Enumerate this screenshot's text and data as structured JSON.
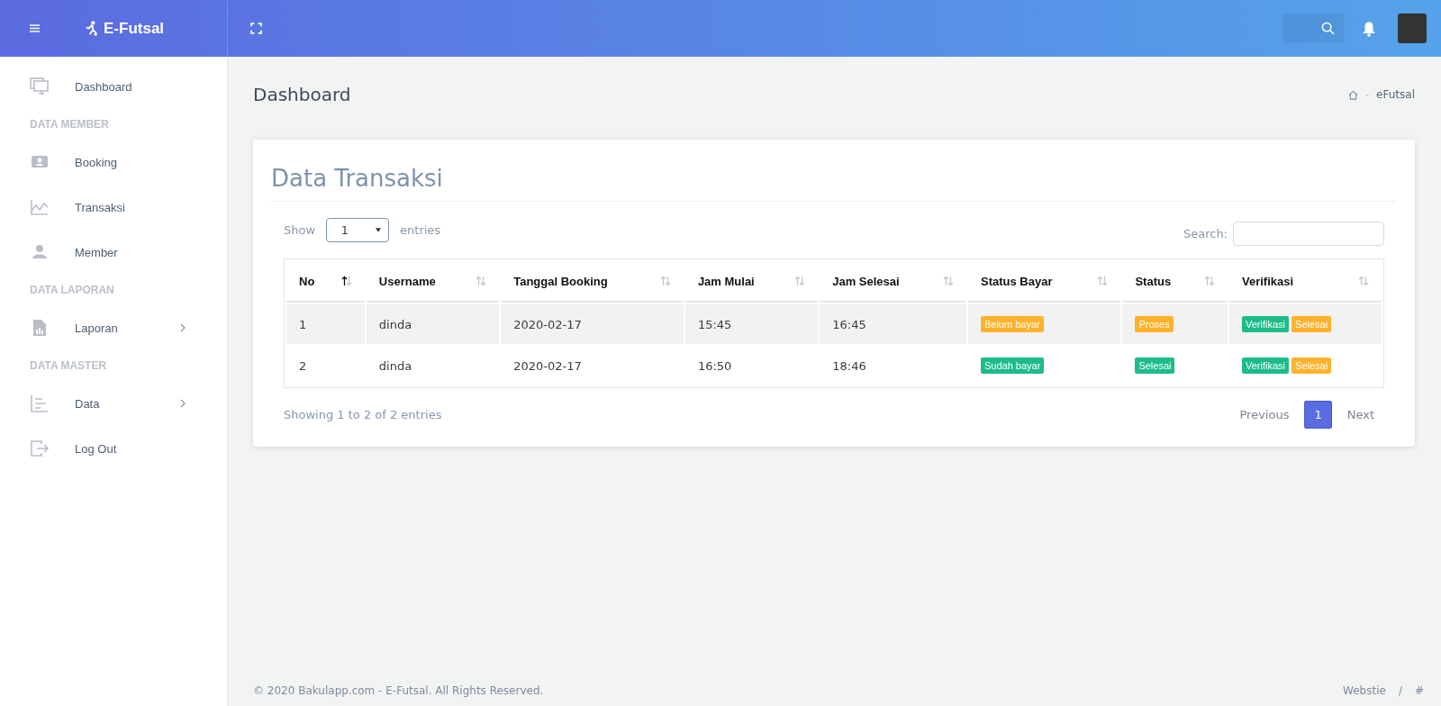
{
  "topbar": {
    "brand": "E-Futsal"
  },
  "sidebar": {
    "items": [
      {
        "kind": "item",
        "label": "Dashboard",
        "has_submenu": false
      },
      {
        "kind": "section",
        "label": "DATA MEMBER"
      },
      {
        "kind": "item",
        "label": "Booking",
        "has_submenu": false
      },
      {
        "kind": "item",
        "label": "Transaksi",
        "has_submenu": false
      },
      {
        "kind": "item",
        "label": "Member",
        "has_submenu": false
      },
      {
        "kind": "section",
        "label": "DATA LAPORAN"
      },
      {
        "kind": "item",
        "label": "Laporan",
        "has_submenu": true
      },
      {
        "kind": "section",
        "label": "DATA MASTER"
      },
      {
        "kind": "item",
        "label": "Data",
        "has_submenu": true
      },
      {
        "kind": "item",
        "label": "Log Out",
        "has_submenu": false
      }
    ]
  },
  "page": {
    "title": "Dashboard",
    "breadcrumb": {
      "separator": "-",
      "current": "eFutsal"
    }
  },
  "card": {
    "title": "Data Transaksi",
    "length": {
      "before": "Show",
      "value": "1",
      "after": "entries"
    },
    "search": {
      "label": "Search:"
    },
    "table": {
      "columns": [
        {
          "label": "No",
          "sorted": true
        },
        {
          "label": "Username",
          "sorted": false
        },
        {
          "label": "Tanggal Booking",
          "sorted": false
        },
        {
          "label": "Jam Mulai",
          "sorted": false
        },
        {
          "label": "Jam Selesai",
          "sorted": false
        },
        {
          "label": "Status Bayar",
          "sorted": false
        },
        {
          "label": "Status",
          "sorted": false
        },
        {
          "label": "Verifikasi",
          "sorted": false
        }
      ],
      "rows": [
        {
          "cells": [
            "1",
            "dinda",
            "2020-02-17",
            "15:45",
            "16:45"
          ],
          "status_bayar": [
            {
              "text": "Belum bayar",
              "color": "#ffb22b"
            }
          ],
          "status": [
            {
              "text": "Proses",
              "color": "#ffb22b"
            }
          ],
          "verifikasi": [
            {
              "text": "Verifikasi",
              "color": "#1ebc8b"
            },
            {
              "text": "Selesai",
              "color": "#ffb22b"
            }
          ]
        },
        {
          "cells": [
            "2",
            "dinda",
            "2020-02-17",
            "16:50",
            "18:46"
          ],
          "status_bayar": [
            {
              "text": "Sudah bayar",
              "color": "#1ebc8b"
            }
          ],
          "status": [
            {
              "text": "Selesai",
              "color": "#1ebc8b"
            }
          ],
          "verifikasi": [
            {
              "text": "Verifikasi",
              "color": "#1ebc8b"
            },
            {
              "text": "Selesai",
              "color": "#ffb22b"
            }
          ]
        }
      ]
    },
    "info": "Showing 1 to 2 of 2 entries",
    "pagination": [
      {
        "label": "Previous",
        "selected": false
      },
      {
        "label": "1",
        "selected": true
      },
      {
        "label": "Next",
        "selected": false
      }
    ]
  },
  "footer": {
    "copyright": "© 2020 Bakulapp.com - E-Futsal. All Rights Reserved.",
    "links": [
      "Webstie",
      "#"
    ],
    "separator": "/"
  }
}
